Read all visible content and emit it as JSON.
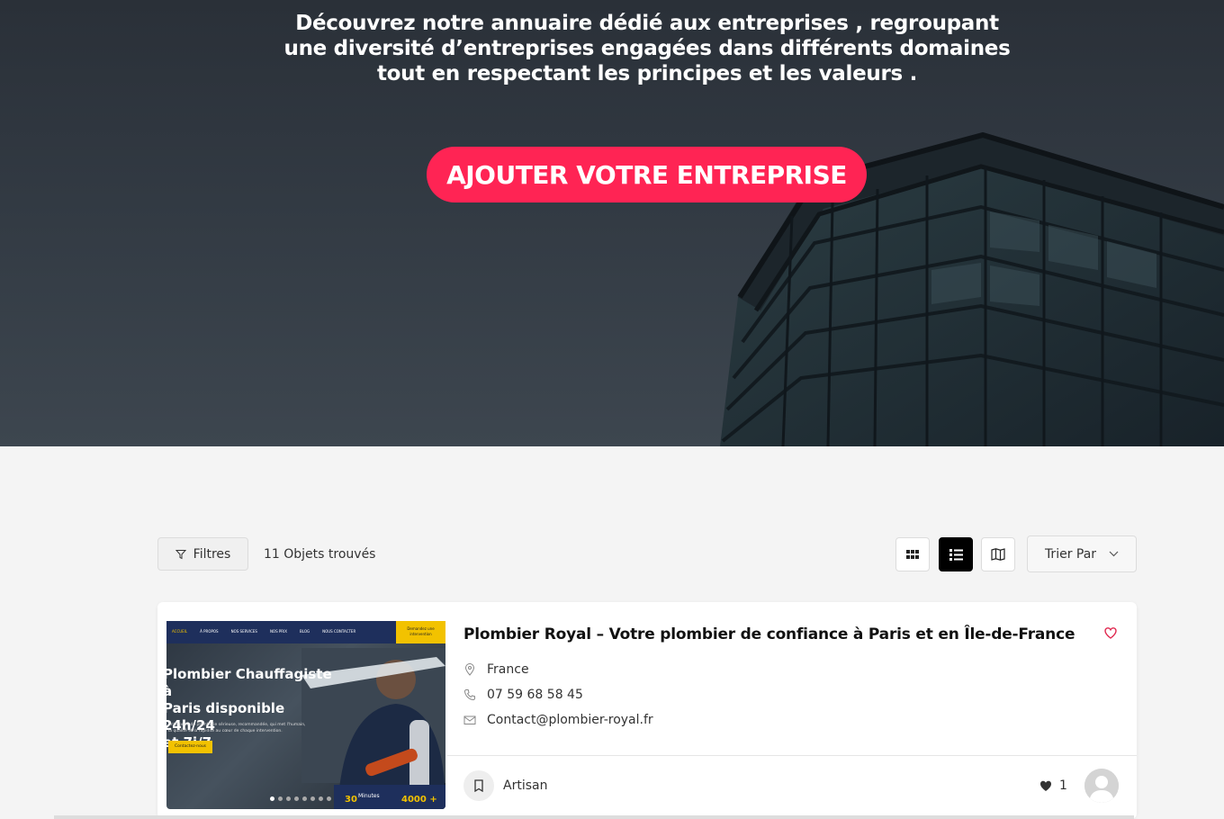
{
  "hero": {
    "description_lines": [
      "Découvrez notre annuaire dédié aux entreprises , regroupant",
      "une diversité d’entreprises engagées dans différents domaines",
      "tout en respectant les principes et les valeurs ."
    ],
    "add_button_label": "AJOUTER VOTRE ENTREPRISE"
  },
  "toolbar": {
    "filters_label": "Filtres",
    "results_count": "11 Objets trouvés",
    "views": [
      "grid-view-icon",
      "list-view-icon",
      "map-view-icon"
    ],
    "active_view": "list",
    "sort_label": "Trier Par"
  },
  "listing": {
    "title": "Plombier Royal – Votre plombier de confiance à Paris et en Île-de-France",
    "location": "France",
    "phone": "07 59 68 58 45",
    "email": "Contact@plombier-royal.fr",
    "category": "Artisan",
    "likes": "1",
    "thumbnail": {
      "nav_items": [
        "ACCUEIL",
        "À PROPOS",
        "NOS SERVICES",
        "NOS PRIX",
        "BLOG",
        "NOUS CONTACTER"
      ],
      "nav_cta": "Demandez une intervention",
      "headline_lines": [
        "Plombier Chauffagiste à",
        "Paris disponible 24h/24",
        "et 7j/7"
      ],
      "subtext": "Entreprise de plomberie sérieuse, recommandée, qui met l'humain, la qualité et la rapidité au cœur de chaque intervention.",
      "cta": "Contactez-nous",
      "stat1_value": "30",
      "stat1_label": "Minutes",
      "stat2_value": "4000 +"
    }
  },
  "colors": {
    "accent": "#ff2454",
    "favorite": "#e0284f",
    "thumb_navy": "#1e2f5c",
    "thumb_yellow": "#f2c200"
  }
}
